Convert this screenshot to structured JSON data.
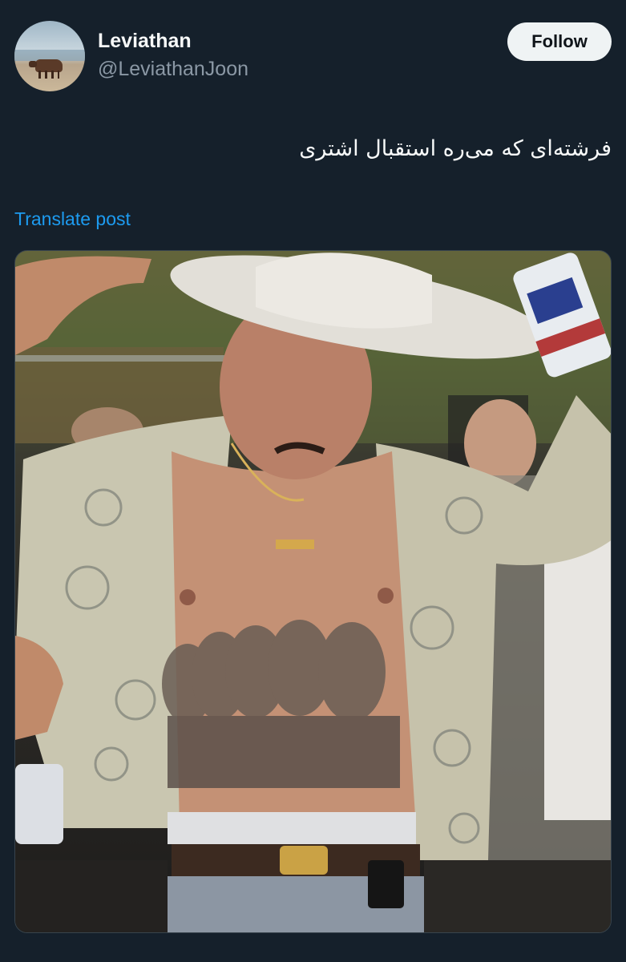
{
  "author": {
    "display_name": "Leviathan",
    "handle": "@LeviathanJoon"
  },
  "follow_button": {
    "label": "Follow"
  },
  "post": {
    "text": "فرشته‌ای که می‌ره استقبال اشتری",
    "translate_label": "Translate post"
  },
  "colors": {
    "background": "#15202b",
    "text_primary": "#f7f9f9",
    "text_secondary": "#8b98a5",
    "link": "#1d9bf0",
    "button_bg": "#eff3f4"
  }
}
